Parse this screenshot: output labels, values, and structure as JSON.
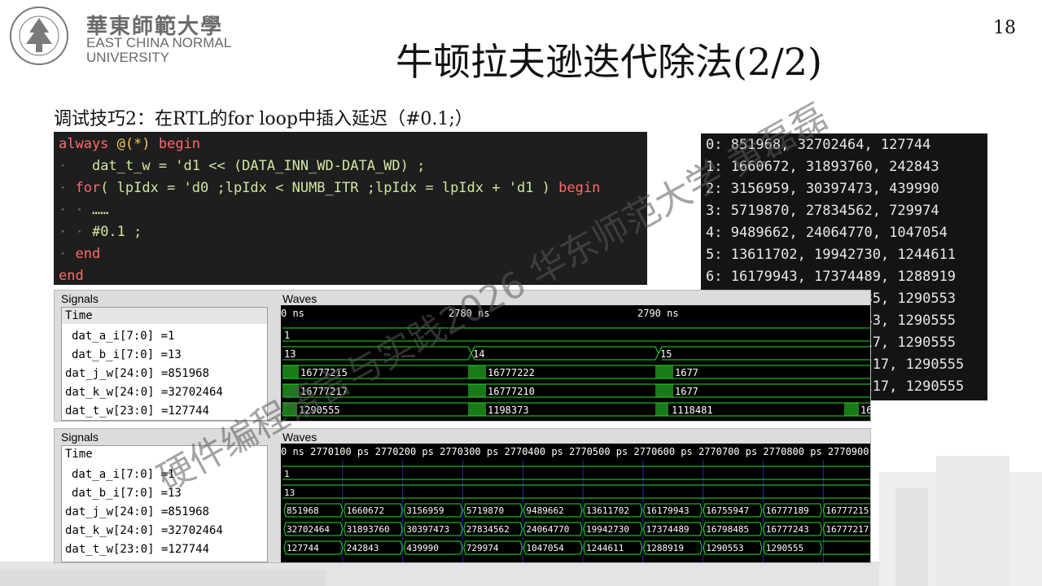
{
  "header": {
    "logo_cn": "華東師範大學",
    "logo_en_line1": "EAST CHINA NORMAL",
    "logo_en_line2": "UNIVERSITY",
    "seal_text": "EAST CHINA NORMAL UNIVERSITY",
    "page_number": "18"
  },
  "slide": {
    "title": "牛顿拉夫逊迭代除法(2/2)",
    "subtitle": "调试技巧2：在RTL的for loop中插入延迟（#0.1;）"
  },
  "code": {
    "l1_kw": "always",
    "l1_rest": " @(*) ",
    "l1_kw2": "begin",
    "l2": "dat_t_w = 'd1 << (DATA_INN_WD-DATA_WD) ;",
    "l3_kw": "for",
    "l3_rest": "( lpIdx = 'd0 ;lpIdx < NUMB_ITR ;lpIdx = lpIdx + 'd1 ) ",
    "l3_kw2": "begin",
    "l4": "……",
    "l5": "#0.1 ;",
    "l6": "end",
    "l7": "end"
  },
  "console": {
    "rows": [
      "0: 851968, 32702464, 127744",
      "1: 1660672, 31893760, 242843",
      "2: 3156959, 30397473, 439990",
      "3: 5719870, 27834562, 729974",
      "4: 9489662, 24064770, 1047054",
      "5: 13611702, 19942730, 1244611",
      "6: 16179943, 17374489, 1288919",
      "7: 16755947, 16798485, 1290553",
      "8: 16777189, 16777243, 1290555",
      "9: 16777215, 16777217, 1290555",
      "10: 16777215, 16777217, 1290555",
      "11: 16777215, 16777217, 1290555"
    ]
  },
  "wave1": {
    "signals_label": "Signals",
    "waves_label": "Waves",
    "time_label": "Time",
    "ruler": [
      "0 ns",
      "2780 ns",
      "2790 ns"
    ],
    "signals": [
      "dat_a_i[7:0] =1",
      "dat_b_i[7:0] =13",
      "dat_j_w[24:0] =851968",
      "dat_k_w[24:0] =32702464",
      "dat_t_w[23:0] =127744"
    ],
    "values": {
      "a": [
        "1"
      ],
      "b": [
        "13",
        "14",
        "15"
      ],
      "j": [
        "16777215",
        "16777222",
        "1677"
      ],
      "k": [
        "16777217",
        "16777210",
        "1677"
      ],
      "t": [
        "1290555",
        "1198373",
        "1118481",
        "16"
      ]
    }
  },
  "wave2": {
    "signals_label": "Signals",
    "waves_label": "Waves",
    "time_label": "Time",
    "ruler": "0 ns  2770100 ps 2770200 ps 2770300 ps 2770400 ps 2770500 ps 2770600 ps 2770700 ps 2770800 ps 2770900 ps   277",
    "signals": [
      "dat_a_i[7:0] =1",
      "dat_b_i[7:0] =13",
      "dat_j_w[24:0] =851968",
      "dat_k_w[24:0] =32702464",
      "dat_t_w[23:0] =127744"
    ],
    "values": {
      "a": [
        "1"
      ],
      "b": [
        "13"
      ],
      "j": [
        "851968",
        "1660672",
        "3156959",
        "5719870",
        "9489662",
        "13611702",
        "16179943",
        "16755947",
        "16777189",
        "16777215"
      ],
      "k": [
        "32702464",
        "31893760",
        "30397473",
        "27834562",
        "24064770",
        "19942730",
        "17374489",
        "16798485",
        "16777243",
        "16777217"
      ],
      "t": [
        "127744",
        "242843",
        "439990",
        "729974",
        "1047054",
        "1244611",
        "1288919",
        "1290553",
        "1290555"
      ]
    }
  },
  "watermark": "硬件编程语言与实践2026 华东师范大学 黄磊磊",
  "colors": {
    "wave_green": "#22e022",
    "code_bg": "#1e1e1e",
    "keyword": "#ff6b6b"
  }
}
